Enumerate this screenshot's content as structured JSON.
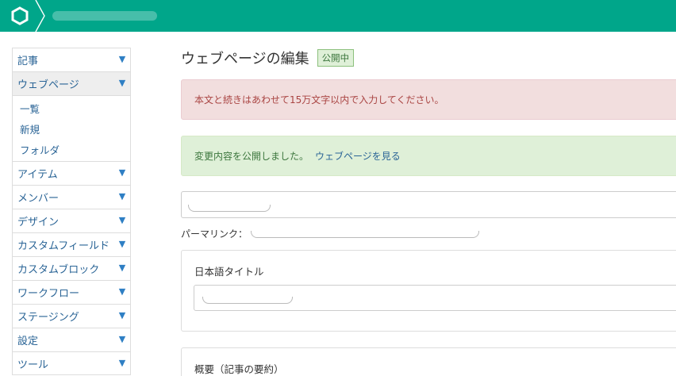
{
  "header": {
    "brand_color": "#00a68a",
    "logo_icon": "a-blog-cms-logo-icon",
    "site_name": ""
  },
  "sidebar": {
    "items": [
      {
        "label": "記事"
      },
      {
        "label": "ウェブページ",
        "active": true,
        "children": [
          {
            "label": "一覧"
          },
          {
            "label": "新規"
          },
          {
            "label": "フォルダ"
          }
        ]
      },
      {
        "label": "アイテム"
      },
      {
        "label": "メンバー"
      },
      {
        "label": "デザイン"
      },
      {
        "label": "カスタムフィールド"
      },
      {
        "label": "カスタムブロック"
      },
      {
        "label": "ワークフロー"
      },
      {
        "label": "ステージング"
      },
      {
        "label": "設定"
      },
      {
        "label": "ツール"
      }
    ],
    "caret_icon": "caret-down-icon"
  },
  "main": {
    "page_title": "ウェブページの編集",
    "status_badge": "公開中",
    "alert_error": "本文と続きはあわせて15万文字以内で入力してください。",
    "alert_success": "変更内容を公開しました。",
    "alert_success_link": "ウェブページを見る",
    "title_value": "",
    "permalink_label": "パーマリンク：",
    "permalink_value": "",
    "panel_title_label": "日本語タイトル",
    "panel_title_value": "",
    "panel_summary_label": "概要（記事の要約）"
  },
  "colors": {
    "error_bg": "#f2dede",
    "error_text": "#a94442",
    "success_bg": "#dff0d8",
    "success_text": "#3c763d",
    "link": "#2a6496"
  }
}
